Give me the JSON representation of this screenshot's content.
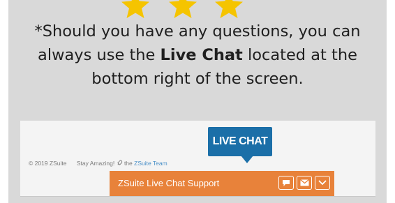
{
  "notice": {
    "prefix": "*Should you have any questions, you can always use the",
    "bold": "Live Chat",
    "suffix": "located at the bottom right of the screen."
  },
  "screenshot": {
    "copyright": "© 2019 ZSuite",
    "tagline": "Stay Amazing!",
    "tagline_from": "the",
    "team_link": "ZSuite Team",
    "live_chat_bubble": "LIVE CHAT",
    "chat_bar_title": "ZSuite Live Chat Support",
    "icons": [
      "chat-icon",
      "mail-icon",
      "chevron-down-icon"
    ]
  },
  "colors": {
    "card_bg": "#d9d9d9",
    "star": "#f5c400",
    "bubble": "#1b6fa8",
    "chat_bar": "#e8823a"
  }
}
